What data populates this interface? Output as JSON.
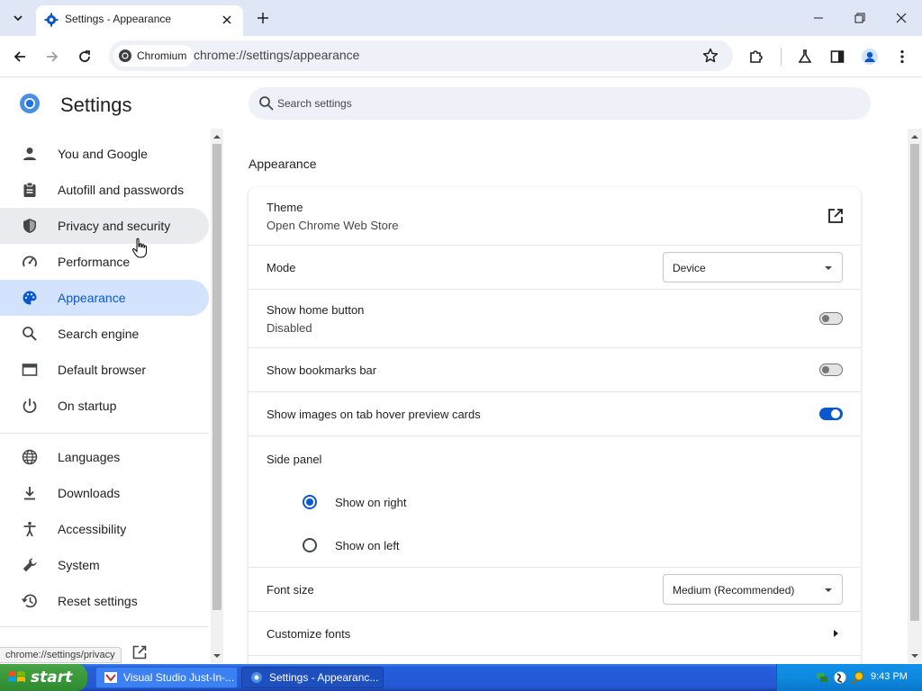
{
  "tab": {
    "title": "Settings - Appearance"
  },
  "toolbar": {
    "chip_label": "Chromium",
    "url": "chrome://settings/appearance"
  },
  "settings": {
    "title": "Settings",
    "search_placeholder": "Search settings"
  },
  "sidebar": {
    "items": [
      {
        "label": "You and Google",
        "icon": "person-icon"
      },
      {
        "label": "Autofill and passwords",
        "icon": "clipboard-icon"
      },
      {
        "label": "Privacy and security",
        "icon": "shield-icon"
      },
      {
        "label": "Performance",
        "icon": "speedometer-icon"
      },
      {
        "label": "Appearance",
        "icon": "palette-icon"
      },
      {
        "label": "Search engine",
        "icon": "search-icon"
      },
      {
        "label": "Default browser",
        "icon": "browser-window-icon"
      },
      {
        "label": "On startup",
        "icon": "power-icon"
      },
      {
        "label": "Languages",
        "icon": "globe-icon"
      },
      {
        "label": "Downloads",
        "icon": "download-icon"
      },
      {
        "label": "Accessibility",
        "icon": "accessibility-icon"
      },
      {
        "label": "System",
        "icon": "wrench-icon"
      },
      {
        "label": "Reset settings",
        "icon": "history-icon"
      }
    ]
  },
  "appearance": {
    "section_title": "Appearance",
    "theme_label": "Theme",
    "theme_sub": "Open Chrome Web Store",
    "mode_label": "Mode",
    "mode_value": "Device",
    "home_label": "Show home button",
    "home_sub": "Disabled",
    "home_enabled": false,
    "bookmarks_label": "Show bookmarks bar",
    "bookmarks_enabled": false,
    "hover_label": "Show images on tab hover preview cards",
    "hover_enabled": true,
    "side_panel_label": "Side panel",
    "side_right_label": "Show on right",
    "side_left_label": "Show on left",
    "side_selected": "right",
    "font_size_label": "Font size",
    "font_size_value": "Medium (Recommended)",
    "customize_fonts_label": "Customize fonts"
  },
  "status_bubble": "chrome://settings/privacy",
  "taskbar": {
    "start_label": "start",
    "tasks": [
      {
        "label": "Visual Studio Just-In-...",
        "active": false
      },
      {
        "label": "Settings - Appearanc...",
        "active": true
      }
    ],
    "clock": "9:43 PM"
  },
  "colors": {
    "accent": "#0b57d0",
    "active_nav_bg": "#d3e3fd",
    "taskbar": "#245edb"
  }
}
